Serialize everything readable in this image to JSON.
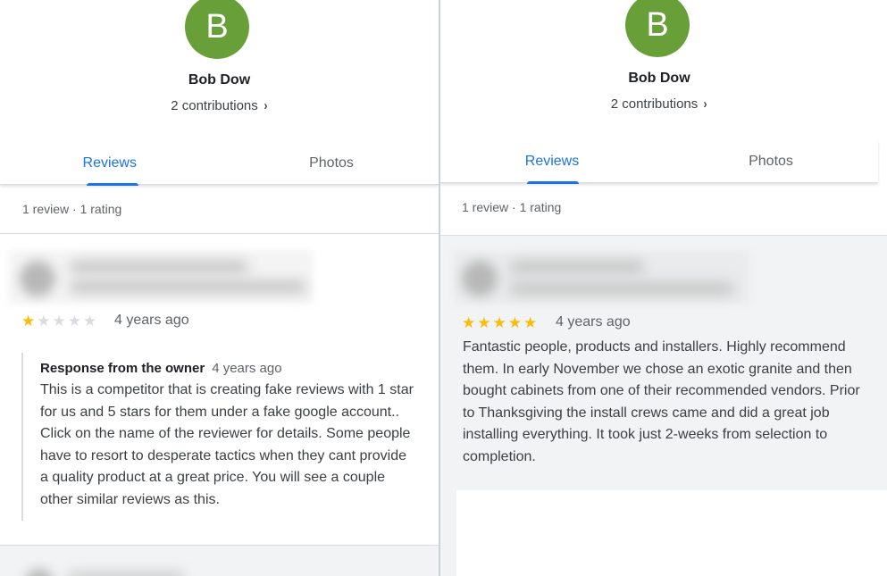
{
  "left": {
    "profile": {
      "avatar_letter": "B",
      "name": "Bob Dow",
      "contributions": "2 contributions",
      "contributions_chevron": "›"
    },
    "tabs": [
      {
        "label": "Reviews",
        "active": true
      },
      {
        "label": "Photos",
        "active": false
      }
    ],
    "summary": "1 review · 1 rating",
    "review": {
      "rating": 1,
      "max_rating": 5,
      "time": "4 years ago",
      "response": {
        "title": "Response from the owner",
        "time": "4 years ago",
        "text": "This is a competitor that is creating fake reviews with 1 star for us and 5 stars for them under a fake google account.. Click on the name of the reviewer for details. Some people have to resort to desperate tactics when they cant provide a quality product at a great price. You will see a couple other similar reviews as this."
      }
    }
  },
  "right": {
    "profile": {
      "avatar_letter": "B",
      "name": "Bob Dow",
      "contributions": "2 contributions",
      "contributions_chevron": "›"
    },
    "tabs": [
      {
        "label": "Reviews",
        "active": true
      },
      {
        "label": "Photos",
        "active": false
      }
    ],
    "summary": "1 review · 1 rating",
    "review": {
      "rating": 5,
      "max_rating": 5,
      "time": "4 years ago",
      "text": "Fantastic people, products and installers. Highly recommend them. In early November we chose an exotic granite and then bought cabinets from one of their recommended vendors. Prior to Thanksgiving the install crews came and did a great job installing everything. It took just 2-weeks from selection to completion."
    }
  },
  "colors": {
    "avatar": "#689f38",
    "accent": "#1a73e8",
    "star_on": "#fbbc04",
    "star_off": "#dadce0"
  },
  "icons": {
    "star": "★",
    "chevron": "chevron-right-icon"
  }
}
